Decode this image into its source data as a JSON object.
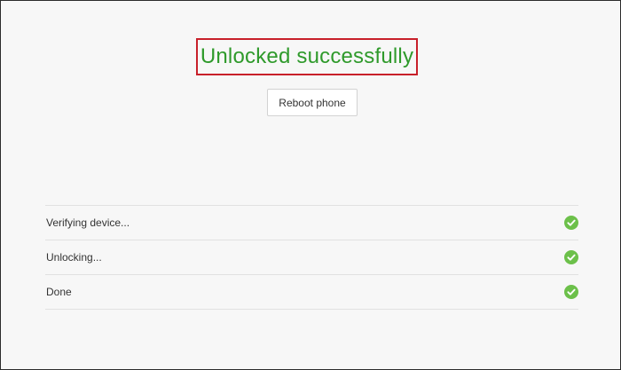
{
  "headline": {
    "text": "Unlocked successfully",
    "color": "#2f9a2b",
    "highlight_color": "#c8202a"
  },
  "actions": {
    "reboot_label": "Reboot phone"
  },
  "steps": [
    {
      "label": "Verifying device...",
      "status": "done",
      "icon": "check-circle-icon"
    },
    {
      "label": "Unlocking...",
      "status": "done",
      "icon": "check-circle-icon"
    },
    {
      "label": "Done",
      "status": "done",
      "icon": "check-circle-icon"
    }
  ],
  "colors": {
    "success": "#6cc04a",
    "divider": "#e1e1e1",
    "background": "#f7f7f7"
  }
}
